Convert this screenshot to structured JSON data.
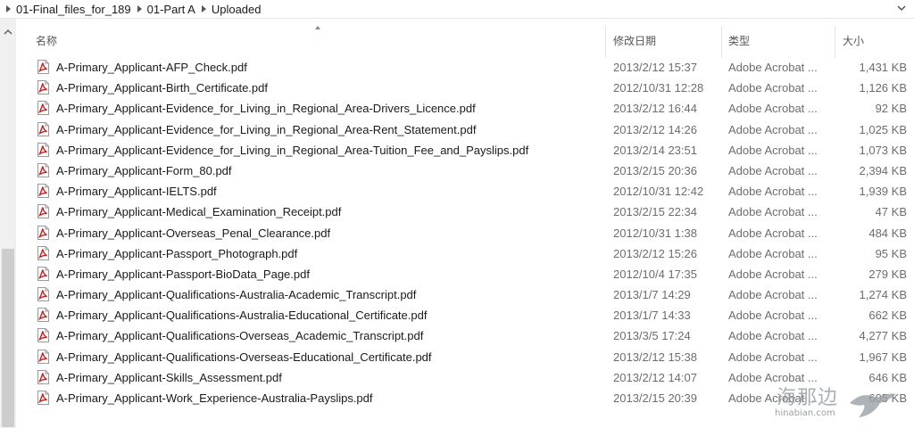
{
  "breadcrumb": {
    "items": [
      "01-Final_files_for_189",
      "01-Part A",
      "Uploaded"
    ]
  },
  "columns": {
    "name": "名称",
    "date": "修改日期",
    "type": "类型",
    "size": "大小"
  },
  "files": [
    {
      "name": "A-Primary_Applicant-AFP_Check.pdf",
      "date": "2013/2/12 15:37",
      "type": "Adobe Acrobat ...",
      "size": "1,431 KB"
    },
    {
      "name": "A-Primary_Applicant-Birth_Certificate.pdf",
      "date": "2012/10/31 12:28",
      "type": "Adobe Acrobat ...",
      "size": "1,126 KB"
    },
    {
      "name": "A-Primary_Applicant-Evidence_for_Living_in_Regional_Area-Drivers_Licence.pdf",
      "date": "2013/2/12 16:44",
      "type": "Adobe Acrobat ...",
      "size": "92 KB"
    },
    {
      "name": "A-Primary_Applicant-Evidence_for_Living_in_Regional_Area-Rent_Statement.pdf",
      "date": "2013/2/12 14:26",
      "type": "Adobe Acrobat ...",
      "size": "1,025 KB"
    },
    {
      "name": "A-Primary_Applicant-Evidence_for_Living_in_Regional_Area-Tuition_Fee_and_Payslips.pdf",
      "date": "2013/2/14 23:51",
      "type": "Adobe Acrobat ...",
      "size": "1,073 KB"
    },
    {
      "name": "A-Primary_Applicant-Form_80.pdf",
      "date": "2013/2/15 20:36",
      "type": "Adobe Acrobat ...",
      "size": "2,394 KB"
    },
    {
      "name": "A-Primary_Applicant-IELTS.pdf",
      "date": "2012/10/31 12:42",
      "type": "Adobe Acrobat ...",
      "size": "1,939 KB"
    },
    {
      "name": "A-Primary_Applicant-Medical_Examination_Receipt.pdf",
      "date": "2013/2/15 22:34",
      "type": "Adobe Acrobat ...",
      "size": "47 KB"
    },
    {
      "name": "A-Primary_Applicant-Overseas_Penal_Clearance.pdf",
      "date": "2012/10/31 1:38",
      "type": "Adobe Acrobat ...",
      "size": "484 KB"
    },
    {
      "name": "A-Primary_Applicant-Passport_Photograph.pdf",
      "date": "2013/2/12 15:26",
      "type": "Adobe Acrobat ...",
      "size": "95 KB"
    },
    {
      "name": "A-Primary_Applicant-Passport-BioData_Page.pdf",
      "date": "2012/10/4 17:35",
      "type": "Adobe Acrobat ...",
      "size": "279 KB"
    },
    {
      "name": "A-Primary_Applicant-Qualifications-Australia-Academic_Transcript.pdf",
      "date": "2013/1/7 14:29",
      "type": "Adobe Acrobat ...",
      "size": "1,274 KB"
    },
    {
      "name": "A-Primary_Applicant-Qualifications-Australia-Educational_Certificate.pdf",
      "date": "2013/1/7 14:33",
      "type": "Adobe Acrobat ...",
      "size": "662 KB"
    },
    {
      "name": "A-Primary_Applicant-Qualifications-Overseas_Academic_Transcript.pdf",
      "date": "2013/3/5 17:24",
      "type": "Adobe Acrobat ...",
      "size": "4,277 KB"
    },
    {
      "name": "A-Primary_Applicant-Qualifications-Overseas-Educational_Certificate.pdf",
      "date": "2013/2/12 15:38",
      "type": "Adobe Acrobat ...",
      "size": "1,967 KB"
    },
    {
      "name": "A-Primary_Applicant-Skills_Assessment.pdf",
      "date": "2013/2/12 14:07",
      "type": "Adobe Acrobat ...",
      "size": "646 KB"
    },
    {
      "name": "A-Primary_Applicant-Work_Experience-Australia-Payslips.pdf",
      "date": "2013/2/15 20:39",
      "type": "Adobe Acrobat ...",
      "size": "605 KB"
    }
  ],
  "watermark": {
    "text": "海那边",
    "sub": "hinabian.com"
  },
  "colors": {
    "pdf_icon_red": "#c8201f",
    "secondary_text": "#6d6d6d"
  },
  "icons": {
    "file": "pdf-file-icon",
    "breadcrumb_separator": "chevron-right-icon",
    "dropdown": "chevron-down-icon",
    "scroll_up": "chevron-up-icon"
  }
}
